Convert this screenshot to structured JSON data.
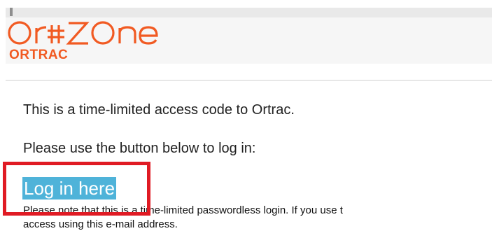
{
  "brand": {
    "wordmark": "ORTZONE",
    "product": "ORTRAC",
    "color": "#f15a22"
  },
  "email": {
    "intro_line": "This is a time-limited access code to Ortrac.",
    "instruction_line": "Please use the button below to log in:",
    "login_link_label": "Log in here",
    "note_line_1": "Please note that this is a time-limited passwordless login. If you use t",
    "note_line_2": "access using this e-mail address."
  },
  "colors": {
    "link_background": "#4fb3d9",
    "highlight_box": "#e01b24"
  }
}
